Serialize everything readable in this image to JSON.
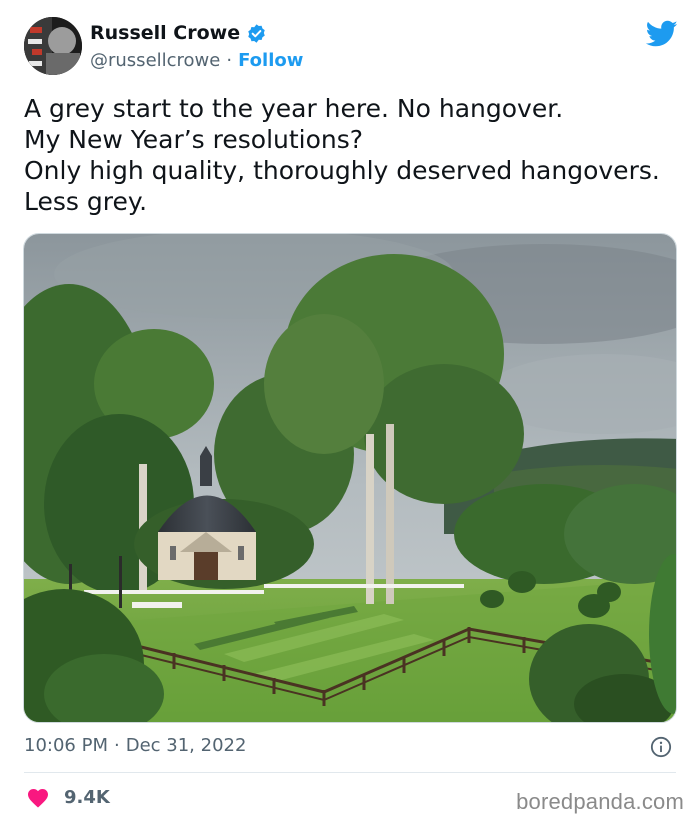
{
  "author": {
    "display_name": "Russell Crowe",
    "handle": "@russellcrowe",
    "separator": "·",
    "follow_label": "Follow"
  },
  "tweet": {
    "lines": [
      "A grey start to the year here. No hangover.",
      "My New Year’s resolutions?",
      "Only high quality, thoroughly deserved hangovers.",
      "Less grey."
    ]
  },
  "meta": {
    "time": "10:06 PM",
    "separator": "·",
    "date": "Dec 31, 2022"
  },
  "engagement": {
    "like_count": "9.4K"
  },
  "watermark": "boredpanda.com",
  "icons": {
    "verified": "verified-badge-icon",
    "brand": "twitter-bird-icon",
    "info": "info-icon",
    "like": "heart-icon"
  },
  "colors": {
    "accent": "#1d9bf0",
    "like": "#f91880",
    "muted": "#536471",
    "text": "#0f1419"
  }
}
